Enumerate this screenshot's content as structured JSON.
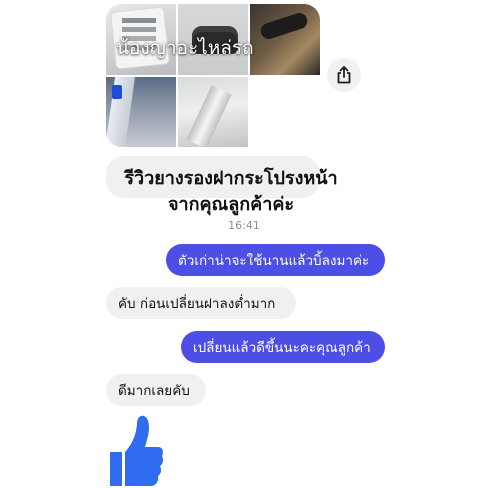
{
  "photo_grid": {
    "caption": "น้องญาอะไหล่รถ"
  },
  "review_message": {
    "line1": "รีวิวยางรองฝากระโปรงหน้า",
    "line2": "จากคุณลูกค้าค่ะ"
  },
  "timestamp": "16:41",
  "messages": [
    {
      "direction": "outgoing",
      "text": "ตัวเก่าน่าจะใช้นานแล้วบิ้ลงมาค่ะ"
    },
    {
      "direction": "incoming",
      "text": "คับ ก่อนเปลี่ยนฝาลงต่ำมาก"
    },
    {
      "direction": "outgoing",
      "text": "เปลี่ยนแล้วดีขึ้นนะคะคุณลูกค้า"
    },
    {
      "direction": "incoming",
      "text": "ดีมากเลยคับ"
    }
  ],
  "reaction": {
    "icon": "thumbs-up-icon"
  },
  "colors": {
    "outgoing_bubble": "#4c4ee6",
    "incoming_bubble": "#f0f0f0",
    "like_blue": "#2f6cf0",
    "timestamp_gray": "#8a8d91"
  }
}
